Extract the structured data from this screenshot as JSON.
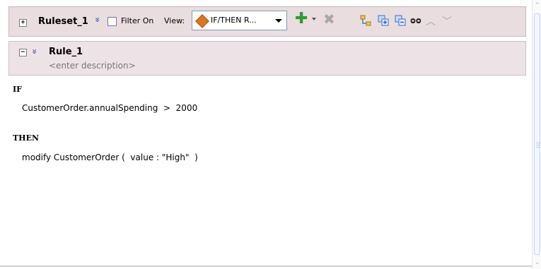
{
  "ruleset": {
    "expander": "+",
    "name": "Ruleset_1",
    "chevrons": "»",
    "filter_label": "Filter On",
    "filter_checked": false,
    "view_label": "View:",
    "view_value": "IF/THEN R...",
    "icons": [
      "add-icon",
      "add-dropdown-icon",
      "delete-icon",
      "tree-icon",
      "expand-all-icon",
      "collapse-all-icon",
      "find-icon",
      "move-up-icon",
      "move-down-icon"
    ]
  },
  "rule": {
    "expander": "−",
    "chevrons": "»",
    "name": "Rule_1",
    "description_placeholder": "<enter description>"
  },
  "body": {
    "if_keyword": "IF",
    "if_statement": "CustomerOrder.annualSpending  >  2000",
    "then_keyword": "THEN",
    "then_statement": "modify CustomerOrder (  value : \"High\"  )"
  },
  "colors": {
    "header_bg": "#e9dde0",
    "rule_bg": "#ede3e6",
    "add_green": "#2f9a2f",
    "chevron_blue": "#3b6fd1",
    "diamond_orange": "#d9781f"
  }
}
